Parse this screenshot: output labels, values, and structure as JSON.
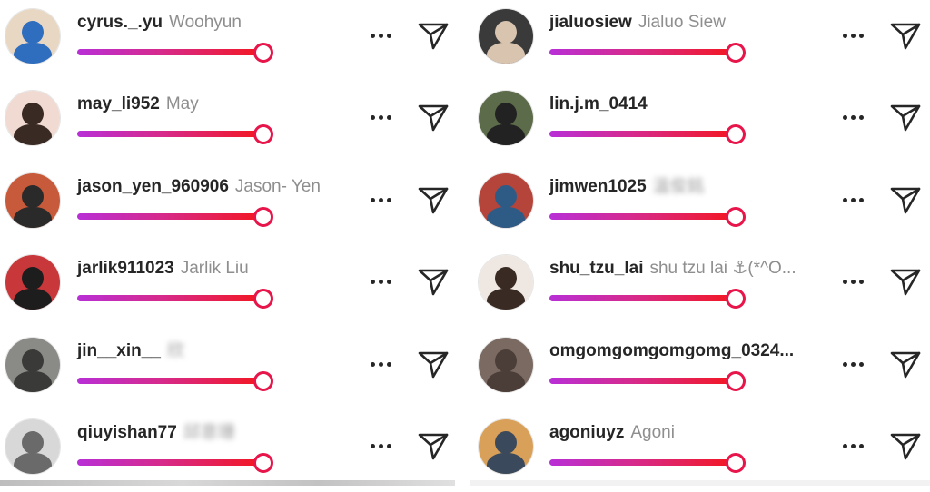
{
  "colors": {
    "text": "#262626",
    "secondary": "#8e8e8e",
    "track_start": "#b82fd6",
    "track_end": "#f4171f",
    "knob": "#e8154a"
  },
  "icons": {
    "more": "more-horizontal-icon",
    "send": "paper-plane-send-icon"
  },
  "left": [
    {
      "username": "cyrus._.yu",
      "fullname": "Woohyun",
      "blurred": false,
      "slider": 0.95,
      "avatar_bg": "#e8d7c2",
      "avatar_fg": "#2f6dbf"
    },
    {
      "username": "may_li952",
      "fullname": "May",
      "blurred": false,
      "slider": 0.95,
      "avatar_bg": "#f0dad2",
      "avatar_fg": "#3a2a24"
    },
    {
      "username": "jason_yen_960906",
      "fullname": "Jason- Yen",
      "blurred": false,
      "slider": 0.95,
      "avatar_bg": "#c75a3a",
      "avatar_fg": "#2a2a2a"
    },
    {
      "username": "jarlik911023",
      "fullname": "Jarlik Liu",
      "blurred": false,
      "slider": 0.95,
      "avatar_bg": "#c8373a",
      "avatar_fg": "#1d1d1d"
    },
    {
      "username": "jin__xin__",
      "fullname": "欣",
      "blurred": true,
      "slider": 0.95,
      "avatar_bg": "#8a8a86",
      "avatar_fg": "#3a3a38"
    },
    {
      "username": "qiuyishan77",
      "fullname": "邱意珊",
      "blurred": true,
      "slider": 0.95,
      "avatar_bg": "#d8d8d8",
      "avatar_fg": "#6a6a6a"
    }
  ],
  "right": [
    {
      "username": "jialuosiew",
      "fullname": "Jialuo Siew",
      "blurred": false,
      "slider": 0.95,
      "avatar_bg": "#3a3a3a",
      "avatar_fg": "#d9c4b0"
    },
    {
      "username": "lin.j.m_0414",
      "fullname": "",
      "blurred": false,
      "slider": 0.95,
      "avatar_bg": "#5c6b4a",
      "avatar_fg": "#222222"
    },
    {
      "username": "jimwen1025",
      "fullname": "溫俊銘",
      "blurred": true,
      "slider": 0.95,
      "avatar_bg": "#b5453a",
      "avatar_fg": "#2e5b86"
    },
    {
      "username": "shu_tzu_lai",
      "fullname": "shu tzu lai ⚓(*^O...",
      "blurred": false,
      "slider": 0.95,
      "avatar_bg": "#efe8e2",
      "avatar_fg": "#3a2a24"
    },
    {
      "username": "omgomgomgomgomg_0324...",
      "fullname": "",
      "blurred": false,
      "slider": 0.95,
      "avatar_bg": "#7a6a62",
      "avatar_fg": "#4b3e38"
    },
    {
      "username": "agoniuyz",
      "fullname": "Agoni",
      "blurred": false,
      "slider": 0.95,
      "avatar_bg": "#d9a05a",
      "avatar_fg": "#3a4a5c"
    }
  ]
}
